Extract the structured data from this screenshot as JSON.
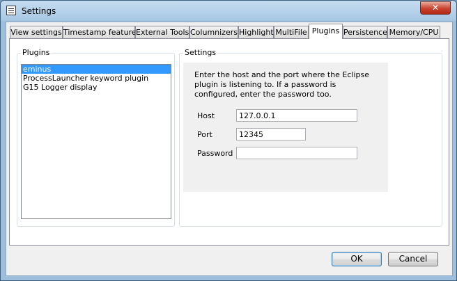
{
  "window": {
    "title": "Settings",
    "close_symbol": "✕",
    "icon": "settings-window-icon"
  },
  "tabs": [
    {
      "label": "View settings"
    },
    {
      "label": "Timestamp features"
    },
    {
      "label": "External Tools"
    },
    {
      "label": "Columnizers"
    },
    {
      "label": "Highlight"
    },
    {
      "label": "MultiFile"
    },
    {
      "label": "Plugins"
    },
    {
      "label": "Persistence"
    },
    {
      "label": "Memory/CPU"
    }
  ],
  "active_tab": "Plugins",
  "plugins_group": {
    "title": "Plugins",
    "items": [
      "eminus",
      "ProcessLauncher keyword plugin",
      "G15 Logger display"
    ],
    "selected": "eminus"
  },
  "settings_group": {
    "title": "Settings",
    "description": "Enter the host and the port where the Eclipse plugin is listening to. If a password is configured, enter the password too.",
    "host_label": "Host",
    "host_value": "127.0.0.1",
    "port_label": "Port",
    "port_value": "12345",
    "password_label": "Password",
    "password_value": ""
  },
  "buttons": {
    "ok": "OK",
    "cancel": "Cancel"
  }
}
